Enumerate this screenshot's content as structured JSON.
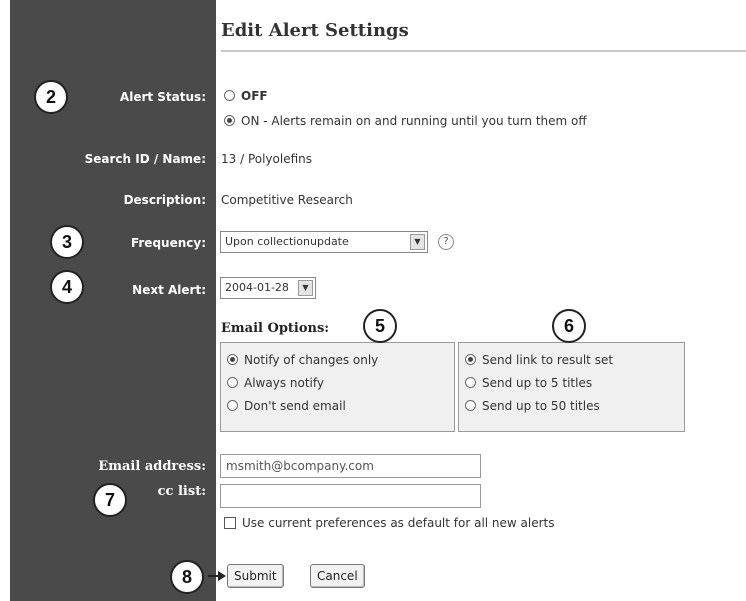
{
  "title": "Edit Alert Settings",
  "alert_status": {
    "label": "Alert Status:",
    "options": [
      "OFF",
      "ON - Alerts remain on and running until you turn them off"
    ],
    "selected_index": 1
  },
  "search_id": {
    "label": "Search ID / Name:",
    "value": "13 / Polyolefins"
  },
  "description": {
    "label": "Description:",
    "value": "Competitive Research"
  },
  "frequency": {
    "label": "Frequency:",
    "value": "Upon collectionupdate",
    "help": "?"
  },
  "next_alert": {
    "label": "Next Alert:",
    "value": "2004-01-28"
  },
  "email_options": {
    "label": "Email Options:",
    "notify": [
      "Notify of changes only",
      "Always notify",
      "Don't send email"
    ],
    "notify_selected": 0,
    "send": [
      "Send link to result set",
      "Send up to 5 titles",
      "Send up to 50 titles"
    ],
    "send_selected": 0
  },
  "email_address": {
    "label": "Email address:",
    "value": "msmith@bcompany.com"
  },
  "cc_list": {
    "label": "cc list:",
    "value": ""
  },
  "default_pref": {
    "label": "Use current preferences as default for all new alerts",
    "checked": false
  },
  "buttons": {
    "submit": "Submit",
    "cancel": "Cancel"
  },
  "callouts": [
    "2",
    "3",
    "4",
    "5",
    "6",
    "7",
    "8"
  ]
}
